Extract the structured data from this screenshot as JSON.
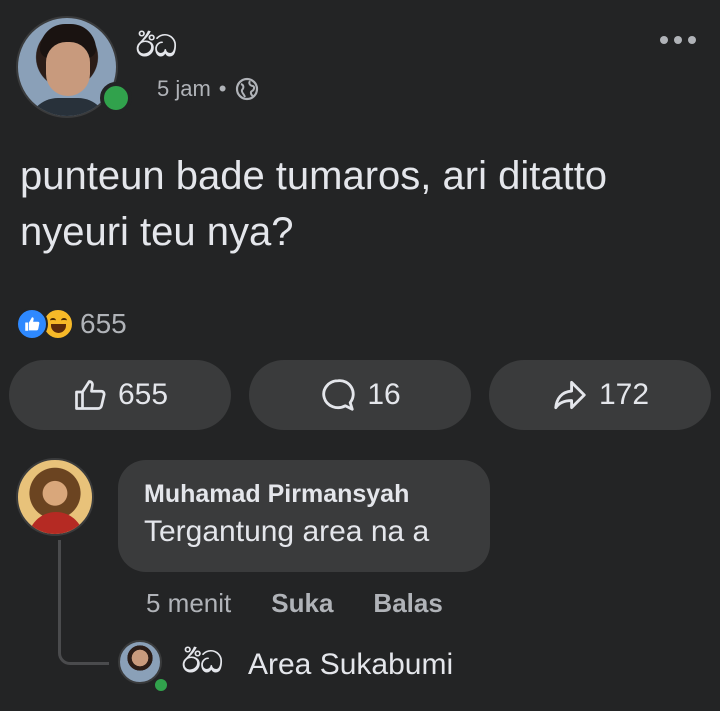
{
  "post": {
    "author": "ඊධ",
    "time": "5 jam",
    "separator": "•",
    "privacy_icon": "globe-icon",
    "more_icon": "more-horizontal-icon",
    "text": "punteun bade tumaros, ari ditatto nyeuri teu nya?",
    "reactions": {
      "types": [
        "like-reaction-icon",
        "haha-reaction-icon"
      ],
      "count": "655"
    }
  },
  "actions": {
    "like_count": "655",
    "comment_count": "16",
    "share_count": "172"
  },
  "comment": {
    "author": "Muhamad Pirmansyah",
    "text": "Tergantung area na a",
    "time": "5 menit",
    "like_label": "Suka",
    "reply_label": "Balas"
  },
  "reply": {
    "author": "ඊධ",
    "text": "Area Sukabumi"
  },
  "colors": {
    "background": "#232425",
    "bubble": "#3a3b3c",
    "text_primary": "#e4e6eb",
    "text_secondary": "#b0b3b8",
    "online": "#31a24c",
    "like_blue": "#2e89ff",
    "haha_yellow": "#f7b928"
  }
}
